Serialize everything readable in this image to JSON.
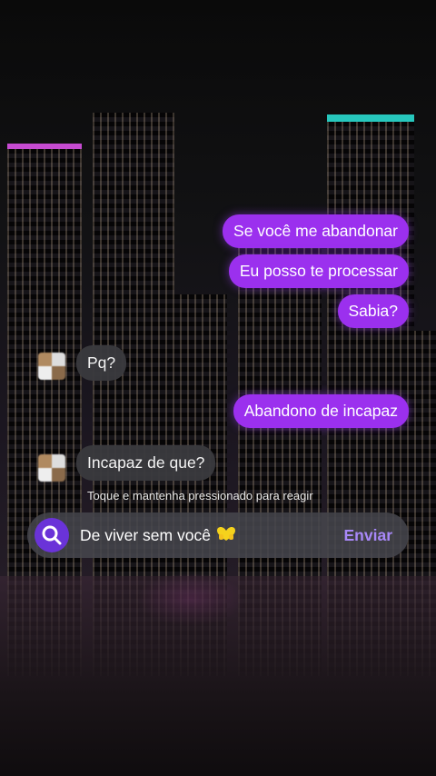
{
  "messages_out": [
    {
      "text": "Se você me abandonar"
    },
    {
      "text": "Eu posso te processar"
    },
    {
      "text": "Sabia?"
    },
    {
      "text": "Abandono de incapaz"
    }
  ],
  "messages_in": [
    {
      "text": "Pq?"
    },
    {
      "text": "Incapaz de que?"
    }
  ],
  "hint": "Toque e mantenha pressionado para reagir",
  "composer": {
    "text": "De viver sem você",
    "send_label": "Enviar",
    "icon": "search-icon",
    "emoji": "yellow-heart-hands-emoji"
  },
  "colors": {
    "bubble_out": "#9b30ee",
    "bubble_in": "#3a3a3e",
    "accent": "#6a33d8",
    "send": "#a888f8"
  }
}
